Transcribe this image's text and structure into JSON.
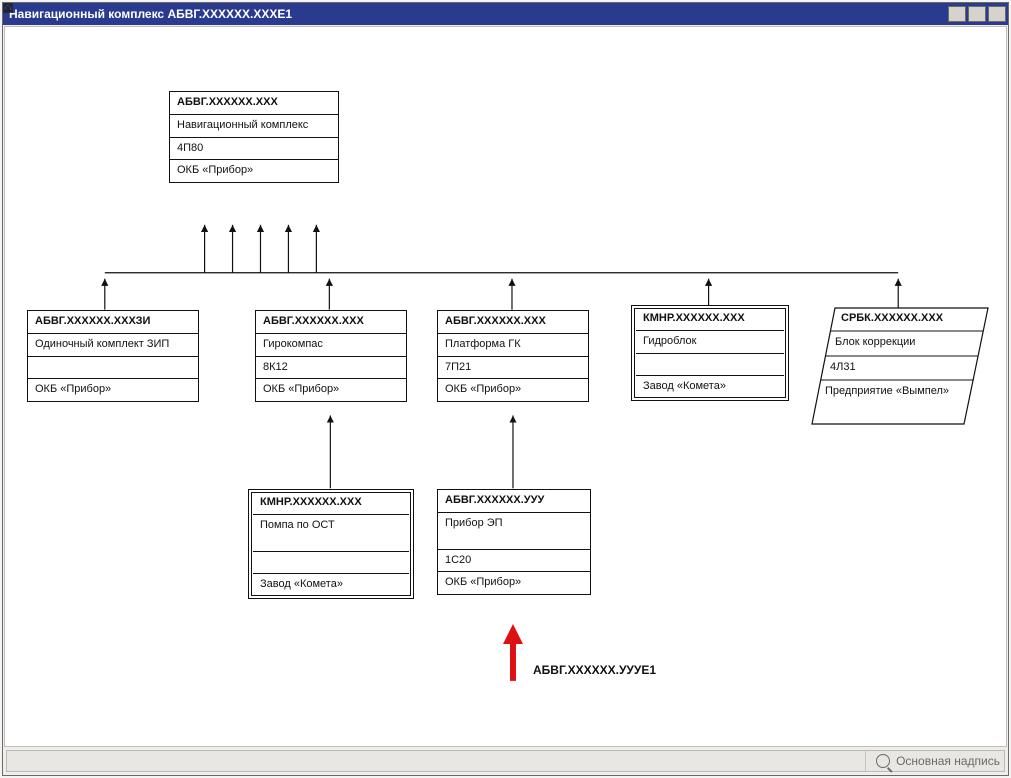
{
  "window": {
    "title": "Навигационный комплекс АБВГ.ХХХХХХ.ХХХЕ1"
  },
  "nodes": {
    "root": {
      "head": "АБВГ.ХХХХХХ.ХХХ",
      "desc": "Навигационный комплекс",
      "code": "4П80",
      "org": "ОКБ «Прибор»"
    },
    "zip": {
      "head": "АБВГ.ХХХХХХ.ХХХЗИ",
      "desc": "Одиночный комплект ЗИП",
      "code": "",
      "org": "ОКБ «Прибор»"
    },
    "gyro": {
      "head": "АБВГ.ХХХХХХ.ХХХ",
      "desc": "Гирокомпас",
      "code": "8К12",
      "org": "ОКБ «Прибор»"
    },
    "platform": {
      "head": "АБВГ.ХХХХХХ.ХХХ",
      "desc": "Платформа ГК",
      "code": "7П21",
      "org": "ОКБ «Прибор»"
    },
    "hydro": {
      "head": "КМНР.ХХХХХХ.ХХХ",
      "desc": "Гидроблок",
      "code": "",
      "org": "Завод «Комета»"
    },
    "corr": {
      "head": "СРБК.ХХХХХХ.ХХХ",
      "desc": "Блок коррекции",
      "code": "4Л31",
      "org": "Предприятие «Вымпел»"
    },
    "pump": {
      "head": "КМНР.ХХХХХХ.ХХХ",
      "desc": "Помпа по ОСТ",
      "code": "",
      "org": "Завод «Комета»"
    },
    "ep": {
      "head": "АБВГ.ХХХХХХ.УУУ",
      "desc": "Прибор ЭП",
      "code": "1С20",
      "org": "ОКБ «Прибор»"
    }
  },
  "annotation": {
    "red_label": "АБВГ.ХХХХХХ.УУУЕ1"
  },
  "statusbar": {
    "search_placeholder": "Основная надпись"
  }
}
